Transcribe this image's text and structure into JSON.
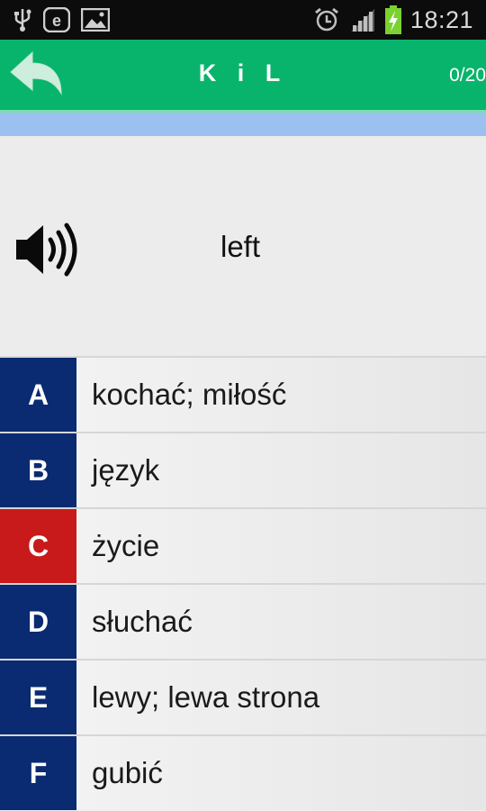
{
  "status_bar": {
    "time": "18:21",
    "icons": [
      "usb-icon",
      "e-notification-icon",
      "image-icon",
      "alarm-icon",
      "signal-icon",
      "battery-charging-icon"
    ]
  },
  "header": {
    "title": "K i L",
    "counter": "0/20",
    "back_icon": "back-arrow-icon",
    "bar_color": "#08b46c",
    "progress": 0
  },
  "question": {
    "speaker_icon": "speaker-icon",
    "word": "left"
  },
  "answers": [
    {
      "letter": "A",
      "text": "kochać; miłość",
      "color": "#0a2a72"
    },
    {
      "letter": "B",
      "text": "język",
      "color": "#0a2a72"
    },
    {
      "letter": "C",
      "text": "życie",
      "color": "#c81a1a"
    },
    {
      "letter": "D",
      "text": "słuchać",
      "color": "#0a2a72"
    },
    {
      "letter": "E",
      "text": "lewy; lewa strona",
      "color": "#0a2a72"
    },
    {
      "letter": "F",
      "text": "gubić",
      "color": "#0a2a72"
    }
  ]
}
